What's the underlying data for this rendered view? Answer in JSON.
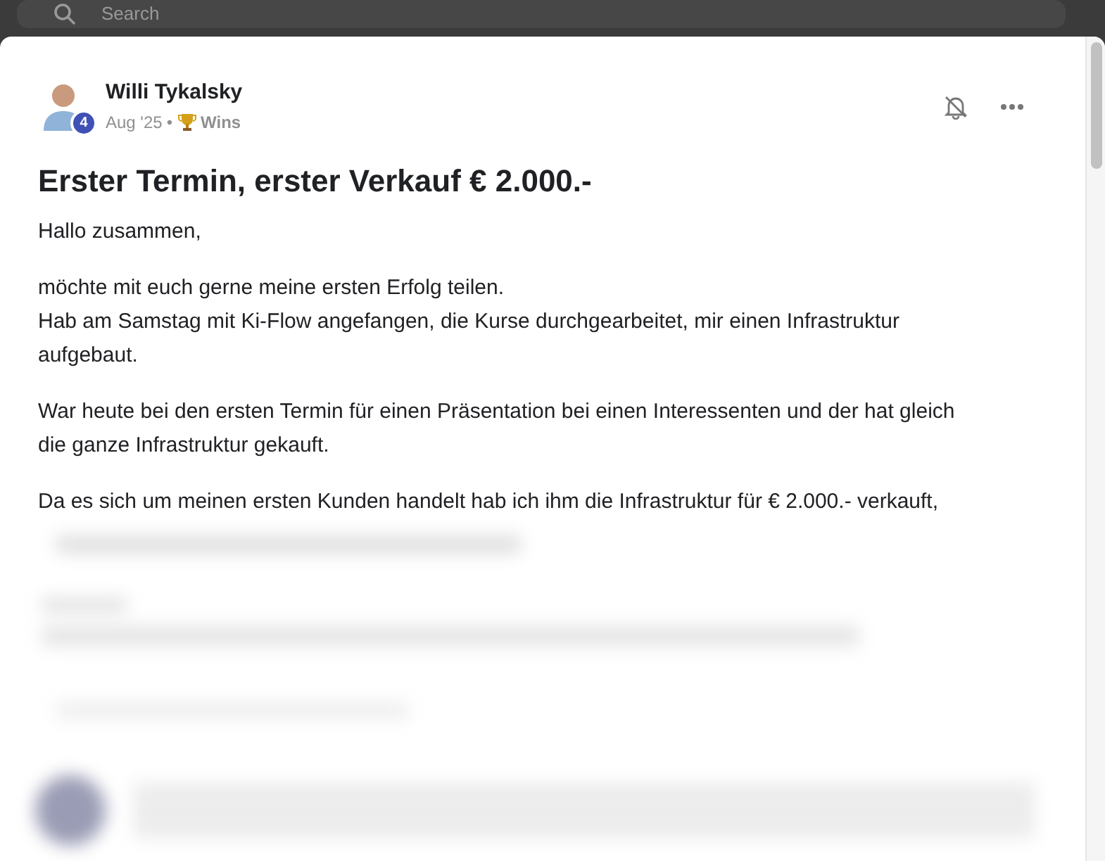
{
  "search": {
    "placeholder": "Search"
  },
  "post": {
    "author": "Willi Tykalsky",
    "level_badge": "4",
    "date": "Aug '25",
    "separator": "•",
    "category": "Wins",
    "title": "Erster Termin, erster Verkauf € 2.000.-",
    "paragraphs": [
      [
        "Hallo zusammen,"
      ],
      [
        "möchte mit euch gerne meine ersten Erfolg teilen.",
        "Hab am Samstag mit Ki-Flow angefangen, die Kurse durchgearbeitet, mir einen Infrastruktur aufgebaut."
      ],
      [
        "War heute bei den ersten Termin für einen Präsentation bei einen Interessenten und der hat gleich die ganze Infrastruktur gekauft."
      ],
      [
        "Da es sich um meinen ersten Kunden handelt hab ich ihm die Infrastruktur für € 2.000.- verkauft,"
      ]
    ]
  }
}
